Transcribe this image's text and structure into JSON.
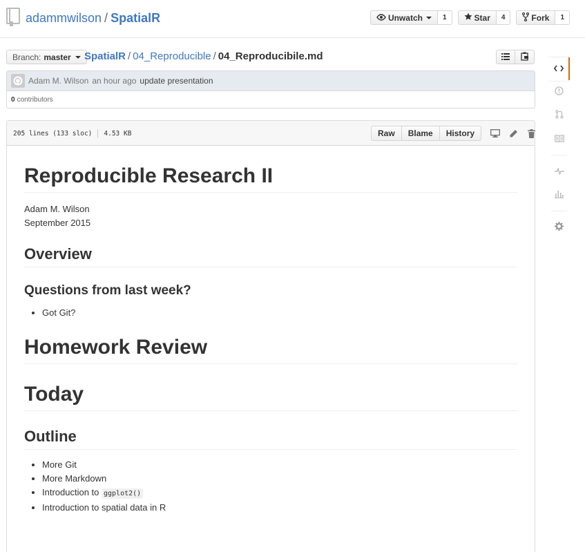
{
  "repo": {
    "owner": "adammwilson",
    "separator": "/",
    "name": "SpatialR"
  },
  "actions": {
    "watch": {
      "label": "Unwatch",
      "count": "1"
    },
    "star": {
      "label": "Star",
      "count": "4"
    },
    "fork": {
      "label": "Fork",
      "count": "1"
    }
  },
  "branch": {
    "prefix": "Branch:",
    "name": "master"
  },
  "breadcrumb": {
    "root": "SpatialR",
    "folder": "04_Reproducible",
    "file": "04_Reproducibile.md",
    "sep": "/"
  },
  "commit": {
    "author": "Adam M. Wilson",
    "time": "an hour ago",
    "message": "update presentation",
    "contributors_count": "0",
    "contributors_label": "contributors"
  },
  "file": {
    "lines": "205 lines (133 sloc)",
    "size": "4.53 KB",
    "buttons": {
      "raw": "Raw",
      "blame": "Blame",
      "history": "History"
    }
  },
  "markdown": {
    "title": "Reproducible Research II",
    "author": "Adam M. Wilson",
    "date": "September 2015",
    "h_overview": "Overview",
    "h_questions": "Questions from last week?",
    "list1": [
      "Got Git?"
    ],
    "h_homework": "Homework Review",
    "h_today": "Today",
    "h_outline": "Outline",
    "list2": {
      "item1": "More Git",
      "item2": "More Markdown",
      "item3_text": "Introduction to ",
      "item3_code": "ggplot2()",
      "item4": "Introduction to spatial data in R"
    }
  },
  "sidebar_icons": [
    "code-icon",
    "issue-icon",
    "pull-request-icon",
    "wiki-icon",
    "pulse-icon",
    "graph-icon",
    "settings-icon"
  ],
  "colors": {
    "link": "#4078c0",
    "selected_accent": "#d26911"
  }
}
